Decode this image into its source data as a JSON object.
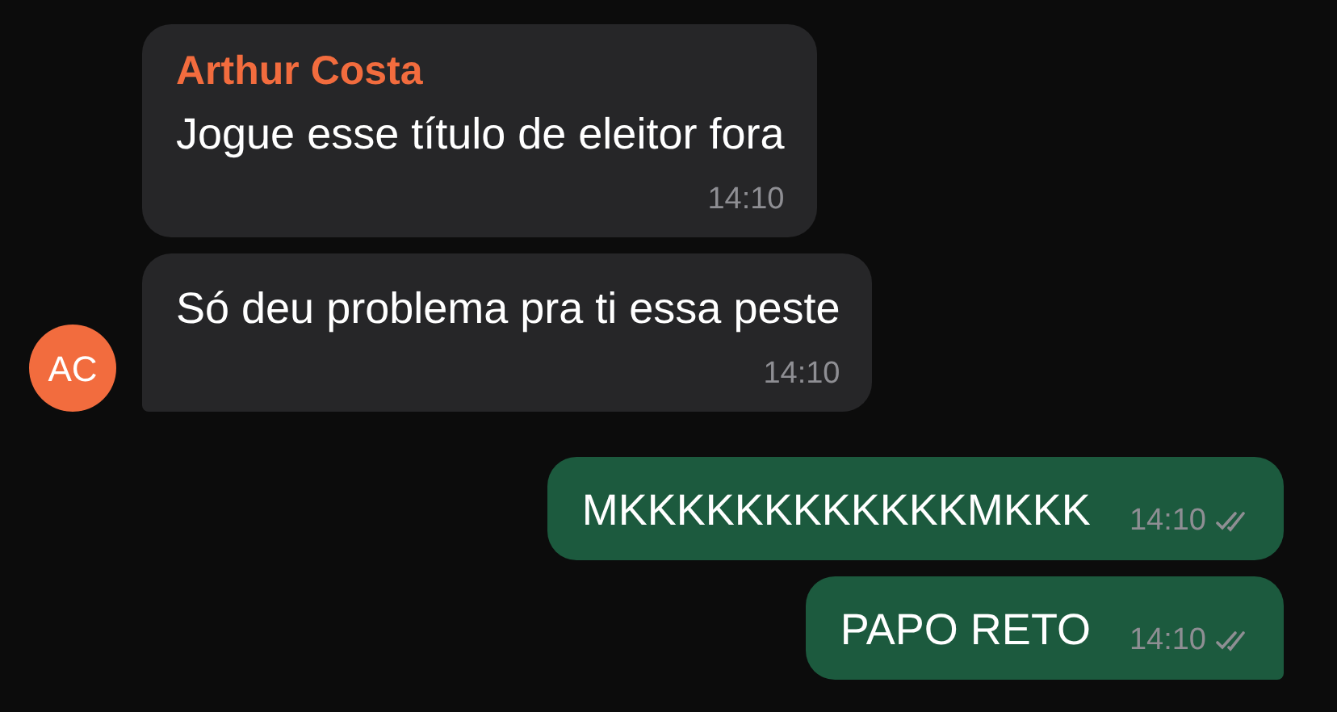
{
  "messages": [
    {
      "kind": "incoming",
      "sender": "Arthur Costa",
      "text": "Jogue esse título de eleitor fora",
      "time": "14:10",
      "tail": false
    },
    {
      "kind": "incoming",
      "text": "Só deu problema pra ti essa peste",
      "time": "14:10",
      "tail": true,
      "avatar": "AC"
    },
    {
      "kind": "outgoing",
      "text": "MKKKKKKKKKKKKMKKK",
      "time": "14:10",
      "read": false,
      "tail": false
    },
    {
      "kind": "outgoing",
      "text": "PAPO RETO",
      "time": "14:10",
      "read": false,
      "tail": true
    }
  ]
}
